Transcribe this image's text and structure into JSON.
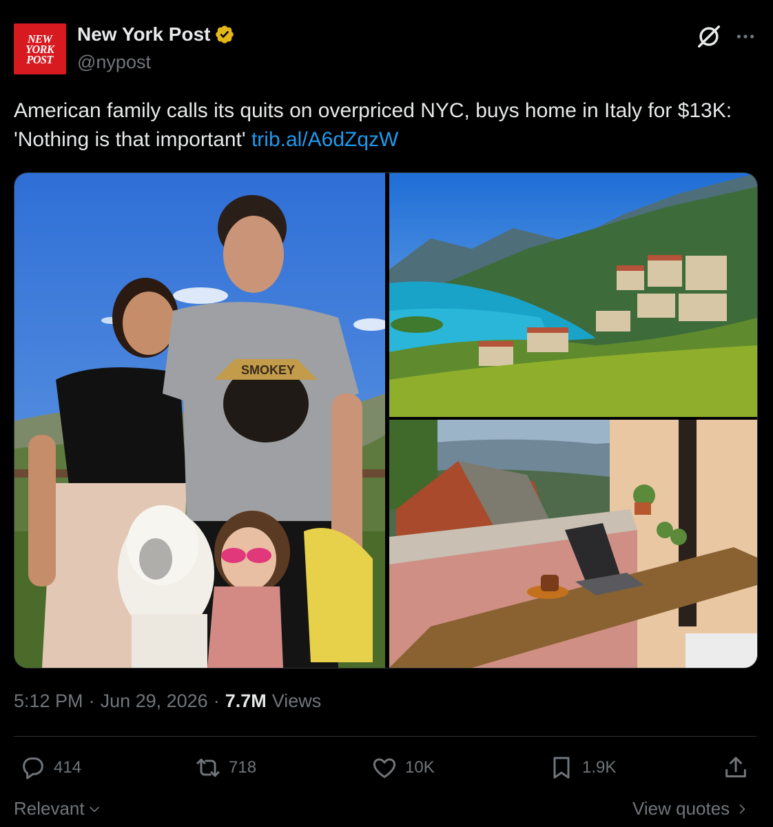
{
  "author": {
    "logo_text": "NEW\nYORK\nPOST",
    "name": "New York Post",
    "handle": "@nypost",
    "verified_badge_color": "#e2b719"
  },
  "header_icons": {
    "grok": "grok-icon",
    "more": "more-icon"
  },
  "tweet": {
    "text": "American family calls its quits on overpriced NYC, buys home in Italy for $13K: 'Nothing is that important' ",
    "link": "trib.al/A6dZqzW",
    "link_color": "#1d9bf0"
  },
  "media": {
    "shirt_text": "SMOKEY"
  },
  "meta": {
    "time": "5:12 PM",
    "separator": "·",
    "date": "Jun 29, 2026",
    "views_count": "7.7M",
    "views_label": "Views"
  },
  "actions": {
    "replies": "414",
    "reposts": "718",
    "likes": "10K",
    "bookmarks": "1.9K"
  },
  "footer": {
    "sort_label": "Relevant",
    "view_quotes": "View quotes"
  },
  "colors": {
    "background": "#000000",
    "text_primary": "#e7e9ea",
    "text_secondary": "#71767b",
    "accent": "#1d9bf0",
    "logo_red": "#d71920"
  }
}
